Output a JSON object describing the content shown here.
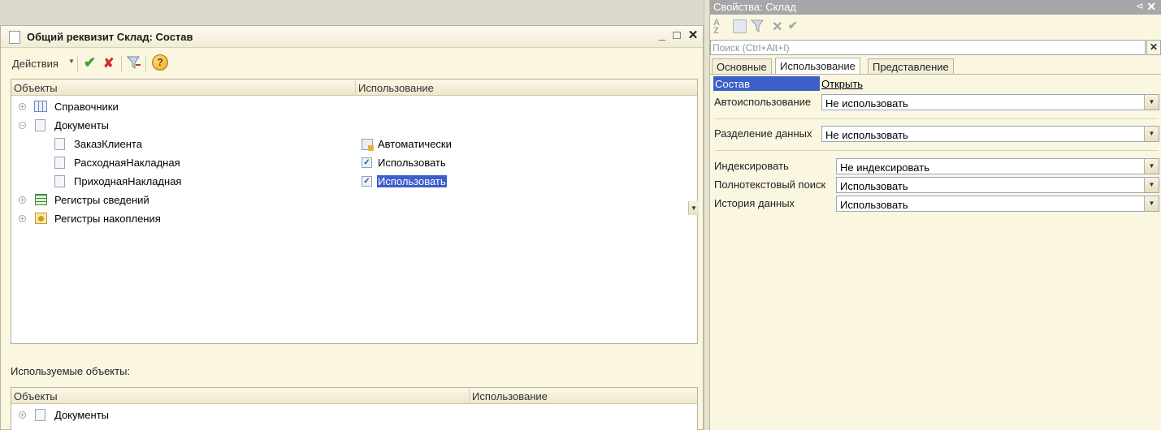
{
  "left_window": {
    "title": "Общий реквизит Склад: Состав",
    "controls": {
      "minimize": "_",
      "maximize": "□",
      "close": "✕"
    },
    "toolbar": {
      "actions_label": "Действия",
      "help": "?"
    },
    "tree": {
      "columns": [
        "Объекты",
        "Использование"
      ],
      "rows": [
        {
          "label": "Справочники",
          "expander": "+",
          "icon": "catalog-icon",
          "usage": ""
        },
        {
          "label": "Документы",
          "expander": "−",
          "icon": "document-icon",
          "usage": ""
        },
        {
          "label": "ЗаказКлиента",
          "icon": "document-icon",
          "usage": "Автоматически",
          "usage_icon": "auto-icon"
        },
        {
          "label": "РасходнаяНакладная",
          "icon": "document-icon",
          "usage": "Использовать",
          "checked": true
        },
        {
          "label": "ПриходнаяНакладная",
          "icon": "document-icon",
          "usage": "Использовать",
          "checked": true,
          "selected": true
        },
        {
          "label": "Регистры сведений",
          "expander": "+",
          "icon": "info-register-icon",
          "usage": ""
        },
        {
          "label": "Регистры накопления",
          "expander": "+",
          "icon": "accumulation-register-icon",
          "usage": ""
        }
      ]
    },
    "used_objects": {
      "label": "Используемые объекты:",
      "columns": [
        "Объекты",
        "Использование"
      ],
      "rows": [
        {
          "label": "Документы",
          "expander": "+",
          "icon": "document-icon"
        }
      ]
    }
  },
  "properties": {
    "title": "Свойства: Склад",
    "search": {
      "placeholder": "Поиск (Ctrl+Alt+I)",
      "value": ""
    },
    "tabs": [
      "Основные",
      "Использование",
      "Представление"
    ],
    "active_tab": "Использование",
    "composition": {
      "label": "Состав",
      "link": "Открыть"
    },
    "fields": {
      "auto_use": {
        "label": "Автоиспользование",
        "value": "Не использовать"
      },
      "data_separation": {
        "label": "Разделение данных",
        "value": "Не использовать"
      },
      "indexing": {
        "label": "Индексировать",
        "value": "Не индексировать"
      },
      "fulltext": {
        "label": "Полнотекстовый поиск",
        "value": "Использовать"
      },
      "history": {
        "label": "История данных",
        "value": "Использовать"
      }
    }
  },
  "colors": {
    "selection": "#3b5ec8",
    "panel_bg": "#fbf6e0",
    "title_gray": "#a7a7a7"
  }
}
